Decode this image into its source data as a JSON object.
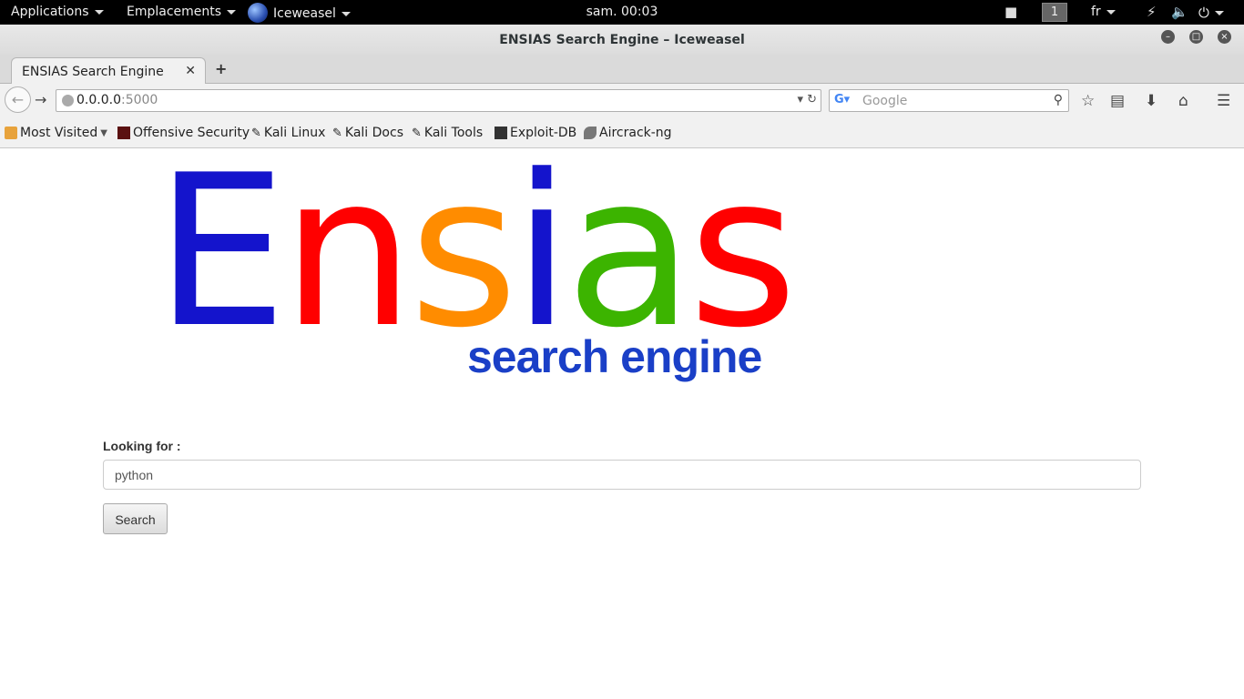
{
  "topbar": {
    "applications": "Applications",
    "places": "Emplacements",
    "app": "Iceweasel",
    "clock": "sam. 00:03",
    "workspace": "1",
    "lang": "fr"
  },
  "window": {
    "title": "ENSIAS Search Engine – Iceweasel"
  },
  "tabs": [
    {
      "label": "ENSIAS Search Engine"
    }
  ],
  "navbar": {
    "url_host": "0.0.0.0",
    "url_port": ":5000",
    "search_placeholder": "Google"
  },
  "bookmarks": [
    {
      "label": "Most Visited",
      "icon": "folder-icon"
    },
    {
      "label": "Offensive Security",
      "icon": "offsec-icon"
    },
    {
      "label": "Kali Linux",
      "icon": "kali-icon"
    },
    {
      "label": "Kali Docs",
      "icon": "kali-icon"
    },
    {
      "label": "Kali Tools",
      "icon": "kali-icon"
    },
    {
      "label": "Exploit-DB",
      "icon": "exploitdb-icon"
    },
    {
      "label": "Aircrack-ng",
      "icon": "aircrack-icon"
    }
  ],
  "page": {
    "logo_letters": [
      {
        "ch": "E",
        "color": "#1414cc"
      },
      {
        "ch": "n",
        "color": "#ff0000"
      },
      {
        "ch": "s",
        "color": "#ff8c00"
      },
      {
        "ch": "i",
        "color": "#1414cc"
      },
      {
        "ch": "a",
        "color": "#3cb400"
      },
      {
        "ch": "s",
        "color": "#ff0000"
      }
    ],
    "subtitle": "search engine",
    "label": "Looking for :",
    "query": "python",
    "button": "Search"
  }
}
